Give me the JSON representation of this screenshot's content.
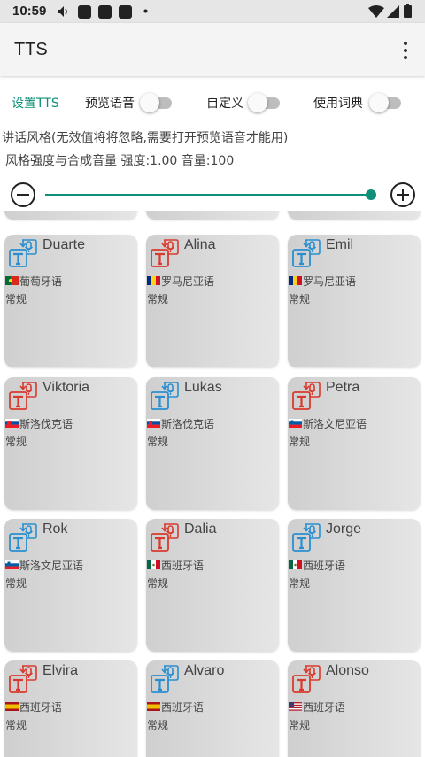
{
  "status": {
    "time": "10:59"
  },
  "app": {
    "title": "TTS"
  },
  "options": {
    "tab_tts": "设置TTS",
    "preview_label": "预览语音",
    "custom_label": "自定义",
    "dict_label": "使用词典"
  },
  "desc": {
    "line1": "讲话风格(无效值将将忽略,需要打开预览语音才能用)",
    "line2": "风格强度与合成音量   强度:1.00 音量:100"
  },
  "slider": {
    "value_fraction": 1.0
  },
  "colors": {
    "accent": "#0f8f78",
    "icon_blue": "#2a8fd0",
    "icon_red": "#d93a2e"
  },
  "voices": [
    {
      "name": "Duarte",
      "lang": "葡萄牙语",
      "style": "常规",
      "icon": "blue",
      "flag": "pt"
    },
    {
      "name": "Alina",
      "lang": "罗马尼亚语",
      "style": "常规",
      "icon": "red",
      "flag": "ro"
    },
    {
      "name": "Emil",
      "lang": "罗马尼亚语",
      "style": "常规",
      "icon": "blue",
      "flag": "ro"
    },
    {
      "name": "Viktoria",
      "lang": "斯洛伐克语",
      "style": "常规",
      "icon": "red",
      "flag": "sk"
    },
    {
      "name": "Lukas",
      "lang": "斯洛伐克语",
      "style": "常规",
      "icon": "blue",
      "flag": "sk"
    },
    {
      "name": "Petra",
      "lang": "斯洛文尼亚语",
      "style": "常规",
      "icon": "red",
      "flag": "si"
    },
    {
      "name": "Rok",
      "lang": "斯洛文尼亚语",
      "style": "常规",
      "icon": "blue",
      "flag": "si"
    },
    {
      "name": "Dalia",
      "lang": "西班牙语",
      "style": "常规",
      "icon": "red",
      "flag": "mx"
    },
    {
      "name": "Jorge",
      "lang": "西班牙语",
      "style": "常规",
      "icon": "blue",
      "flag": "mx"
    },
    {
      "name": "Elvira",
      "lang": "西班牙语",
      "style": "常规",
      "icon": "red",
      "flag": "es"
    },
    {
      "name": "Alvaro",
      "lang": "西班牙语",
      "style": "常规",
      "icon": "blue",
      "flag": "es"
    },
    {
      "name": "Alonso",
      "lang": "西班牙语",
      "style": "常规",
      "icon": "red",
      "flag": "us"
    }
  ]
}
